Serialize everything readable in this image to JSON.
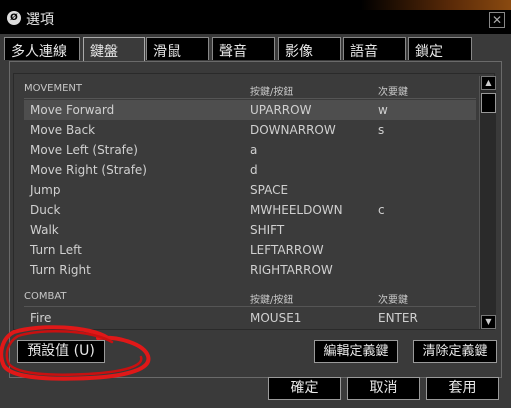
{
  "window": {
    "title": "選項",
    "close_label": "✕",
    "app_icon_label": "Ø"
  },
  "tabs": [
    {
      "label": "多人連線",
      "active": false
    },
    {
      "label": "鍵盤",
      "active": true
    },
    {
      "label": "滑鼠",
      "active": false
    },
    {
      "label": "聲音",
      "active": false
    },
    {
      "label": "影像",
      "active": false
    },
    {
      "label": "語音",
      "active": false
    },
    {
      "label": "鎖定",
      "active": false
    }
  ],
  "keyboard": {
    "movement_header": {
      "section": "MOVEMENT",
      "key": "按鍵/按鈕",
      "alt": "次要鍵"
    },
    "movement_rows": [
      {
        "action": "Move Forward",
        "key": "UPARROW",
        "alt": "w",
        "selected": true
      },
      {
        "action": "Move Back",
        "key": "DOWNARROW",
        "alt": "s"
      },
      {
        "action": "Move Left (Strafe)",
        "key": "a",
        "alt": ""
      },
      {
        "action": "Move Right (Strafe)",
        "key": "d",
        "alt": ""
      },
      {
        "action": "Jump",
        "key": "SPACE",
        "alt": ""
      },
      {
        "action": "Duck",
        "key": "MWHEELDOWN",
        "alt": "c"
      },
      {
        "action": "Walk",
        "key": "SHIFT",
        "alt": ""
      },
      {
        "action": "Turn Left",
        "key": "LEFTARROW",
        "alt": ""
      },
      {
        "action": "Turn Right",
        "key": "RIGHTARROW",
        "alt": ""
      }
    ],
    "combat_header": {
      "section": "COMBAT",
      "key": "按鍵/按鈕",
      "alt": "次要鍵"
    },
    "combat_rows": [
      {
        "action": "Fire",
        "key": "MOUSE1",
        "alt": "ENTER"
      }
    ],
    "scroll_up": "▲",
    "scroll_down": "▼"
  },
  "buttons": {
    "defaults": "預設值 (U)",
    "edit_key": "編輯定義鍵",
    "clear_key": "清除定義鍵",
    "ok": "確定",
    "cancel": "取消",
    "apply": "套用"
  },
  "colors": {
    "background": "#3a3a3a",
    "titlebar": "#000000",
    "annotation": "#e01818"
  }
}
